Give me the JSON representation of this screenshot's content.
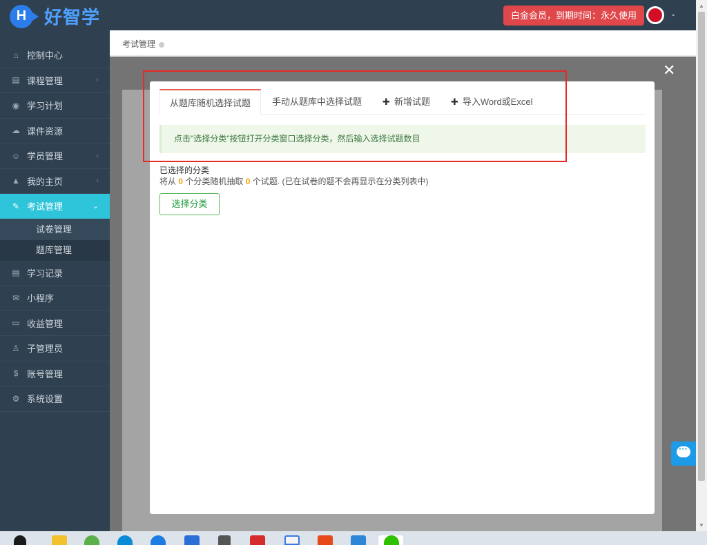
{
  "app": {
    "logo_letter": "H",
    "logo_text": "好智学"
  },
  "header": {
    "member_badge": "白金会员，到期时间：永久使用",
    "avatar_caret": "⌄"
  },
  "sidebar": {
    "items": [
      {
        "label": "控制中心",
        "icon": "home-icon",
        "glyph": "⌂"
      },
      {
        "label": "课程管理",
        "icon": "book-icon",
        "glyph": "▤",
        "arrow": "‹"
      },
      {
        "label": "学习计划",
        "icon": "eye-icon",
        "glyph": "◉"
      },
      {
        "label": "课件资源",
        "icon": "cloud-icon",
        "glyph": "☁"
      },
      {
        "label": "学员管理",
        "icon": "users-icon",
        "glyph": "☺",
        "arrow": "‹"
      },
      {
        "label": "我的主页",
        "icon": "graduation-cap-icon",
        "glyph": "▲",
        "arrow": "‹"
      },
      {
        "label": "考试管理",
        "icon": "exam-icon",
        "glyph": "✎",
        "arrow": "⌄"
      },
      {
        "label": "学习记录",
        "icon": "record-book-icon",
        "glyph": "▤"
      },
      {
        "label": "小程序",
        "icon": "wechat-icon",
        "glyph": "✉"
      },
      {
        "label": "收益管理",
        "icon": "card-icon",
        "glyph": "▭"
      },
      {
        "label": "子管理员",
        "icon": "admin-icon",
        "glyph": "♙"
      },
      {
        "label": "账号管理",
        "icon": "dollar-icon",
        "glyph": "$"
      },
      {
        "label": "系统设置",
        "icon": "gear-icon",
        "glyph": "⚙"
      }
    ],
    "sub_items": [
      {
        "label": "试卷管理"
      },
      {
        "label": "题库管理"
      }
    ]
  },
  "breadcrumb": {
    "label": "考试管理"
  },
  "modal": {
    "close": "✕",
    "tabs": [
      {
        "label": "从题库随机选择试题"
      },
      {
        "label": "手动从题库中选择试题"
      },
      {
        "label": "新增试题",
        "plus": "✚"
      },
      {
        "label": "导入Word或Excel",
        "plus": "✚"
      }
    ],
    "tip": "点击\"选择分类\"按钮打开分类窗口选择分类，然后输入选择试题数目",
    "selected_label": "已选择的分类",
    "info_prefix": "将从",
    "category_count": "0",
    "info_mid": "个分类随机抽取",
    "question_count": "0",
    "info_suffix": "个试题. (已在试卷的题不会再显示在分类列表中)",
    "select_button": "选择分类"
  },
  "colors": {
    "sidebar_bg": "#2f4050",
    "active_item": "#2ec4d9",
    "member_badge": "#e0474b",
    "highlight_border": "#e52b25",
    "tab_active_top": "#e6594d",
    "button_green": "#5cb85c"
  }
}
